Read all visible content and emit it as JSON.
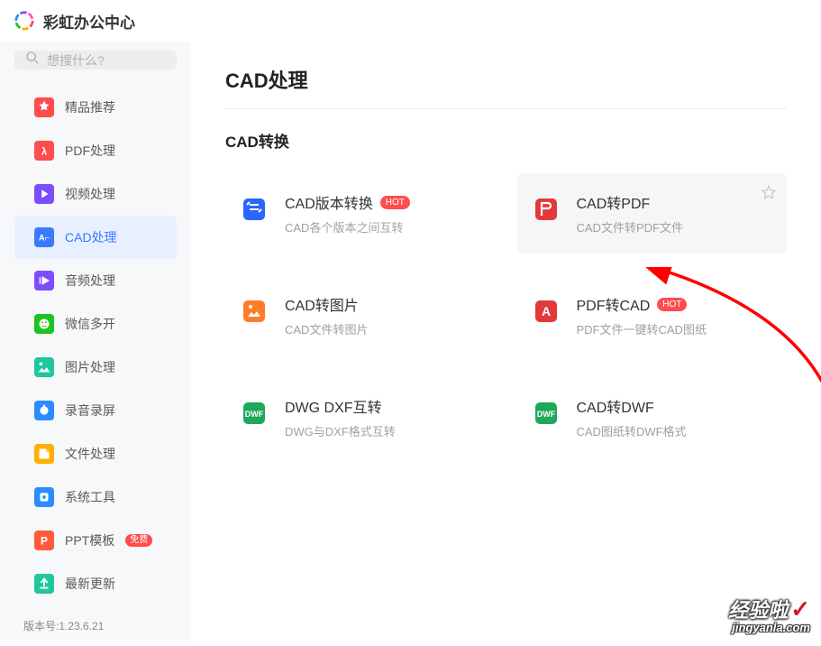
{
  "header": {
    "title": "彩虹办公中心"
  },
  "sidebar": {
    "search_placeholder": "想搜什么?",
    "items": [
      {
        "label": "精品推荐",
        "icon_color": "#ff4d4d"
      },
      {
        "label": "PDF处理",
        "icon_color": "#ff4d4d"
      },
      {
        "label": "视频处理",
        "icon_color": "#7c4dff"
      },
      {
        "label": "CAD处理",
        "icon_color": "#3a7afe",
        "active": true
      },
      {
        "label": "音频处理",
        "icon_color": "#7c4dff"
      },
      {
        "label": "微信多开",
        "icon_color": "#1ec31e"
      },
      {
        "label": "图片处理",
        "icon_color": "#1ec79e"
      },
      {
        "label": "录音录屏",
        "icon_color": "#2a8cff"
      },
      {
        "label": "文件处理",
        "icon_color": "#ffb000"
      },
      {
        "label": "系统工具",
        "icon_color": "#2a8cff"
      },
      {
        "label": "PPT模板",
        "icon_color": "#ff5a3c",
        "badge": "免费"
      },
      {
        "label": "最新更新",
        "icon_color": "#1ec79e"
      }
    ],
    "version": "版本号:1.23.6.21"
  },
  "content": {
    "page_title": "CAD处理",
    "section_title": "CAD转换",
    "tools": [
      {
        "title": "CAD版本转换",
        "desc": "CAD各个版本之间互转",
        "icon_color": "#2a66ff",
        "badge": "HOT"
      },
      {
        "title": "CAD转PDF",
        "desc": "CAD文件转PDF文件",
        "icon_color": "#e23a3a",
        "hovered": true
      },
      {
        "title": "CAD转图片",
        "desc": "CAD文件转图片",
        "icon_color": "#ff7c2a"
      },
      {
        "title": "PDF转CAD",
        "desc": "PDF文件一键转CAD图纸",
        "icon_color": "#e23a3a",
        "badge": "HOT"
      },
      {
        "title": "DWG DXF互转",
        "desc": "DWG与DXF格式互转",
        "icon_color": "#1ea85a"
      },
      {
        "title": "CAD转DWF",
        "desc": "CAD图纸转DWF格式",
        "icon_color": "#1ea85a"
      }
    ]
  },
  "watermark": {
    "text": "经验啦",
    "url": "jingyanla.com"
  }
}
